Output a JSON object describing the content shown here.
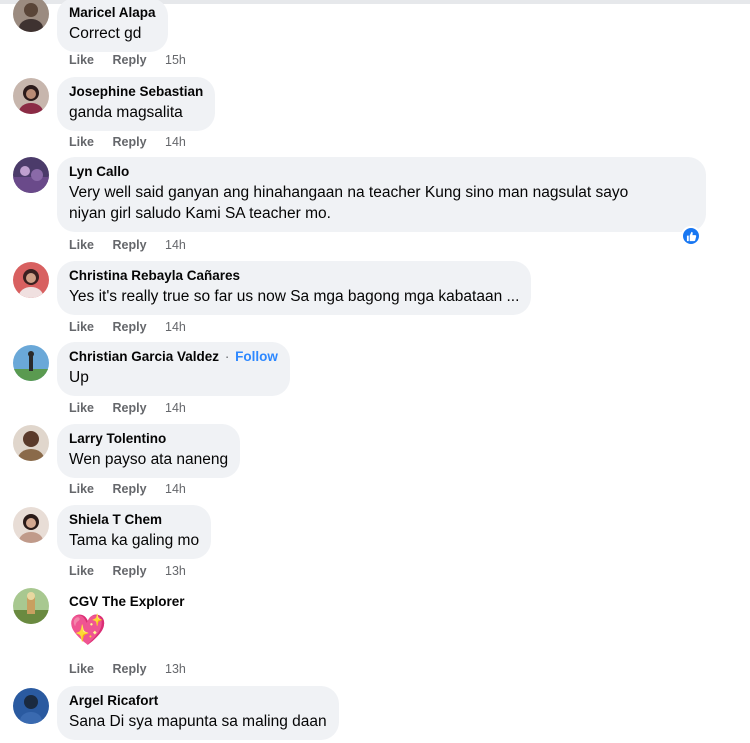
{
  "comments": [
    {
      "name": "Maricel Alapa",
      "text": "Correct gd",
      "like": "Like",
      "reply": "Reply",
      "time": "15h",
      "avatar_color": "#7a6a60"
    },
    {
      "name": "Josephine Sebastian",
      "text": "ganda magsalita",
      "like": "Like",
      "reply": "Reply",
      "time": "14h",
      "avatar_color": "#8b2b45"
    },
    {
      "name": "Lyn Callo",
      "text_line1": "Very well said ganyan ang hinahangaan na teacher Kung sino man nagsulat sayo",
      "text_line2": "niyan girl saludo Kami SA teacher mo.",
      "like": "Like",
      "reply": "Reply",
      "time": "14h",
      "avatar_color": "#6a4a8a",
      "reaction": "like-reaction"
    },
    {
      "name": "Christina Rebayla Cañares",
      "text": "Yes it's really true so far us now Sa mga bagong mga kabataan ...",
      "like": "Like",
      "reply": "Reply",
      "time": "14h",
      "avatar_color": "#c04a4a"
    },
    {
      "name": "Christian Garcia Valdez",
      "separator": "·",
      "follow": "Follow",
      "text": "Up",
      "like": "Like",
      "reply": "Reply",
      "time": "14h",
      "avatar_color": "#4a8ac0"
    },
    {
      "name": "Larry Tolentino",
      "text": "Wen payso ata naneng",
      "like": "Like",
      "reply": "Reply",
      "time": "14h",
      "avatar_color": "#8a6a4a"
    },
    {
      "name": "Shiela T Chem",
      "text": "Tama ka galing mo",
      "like": "Like",
      "reply": "Reply",
      "time": "13h",
      "avatar_color": "#c09a8a"
    },
    {
      "name": "CGV The Explorer",
      "emoji": "💖",
      "like": "Like",
      "reply": "Reply",
      "time": "13h",
      "avatar_color": "#8aa060"
    },
    {
      "name": "Argel Ricafort",
      "text": "Sana Di sya mapunta sa maling daan",
      "like": "Like",
      "reply": "Reply",
      "avatar_color": "#2a5aa0"
    }
  ],
  "colors": {
    "bubble": "#f0f2f5",
    "meta": "#65676b",
    "follow": "#2d88ff",
    "reaction": "#1877f2"
  }
}
